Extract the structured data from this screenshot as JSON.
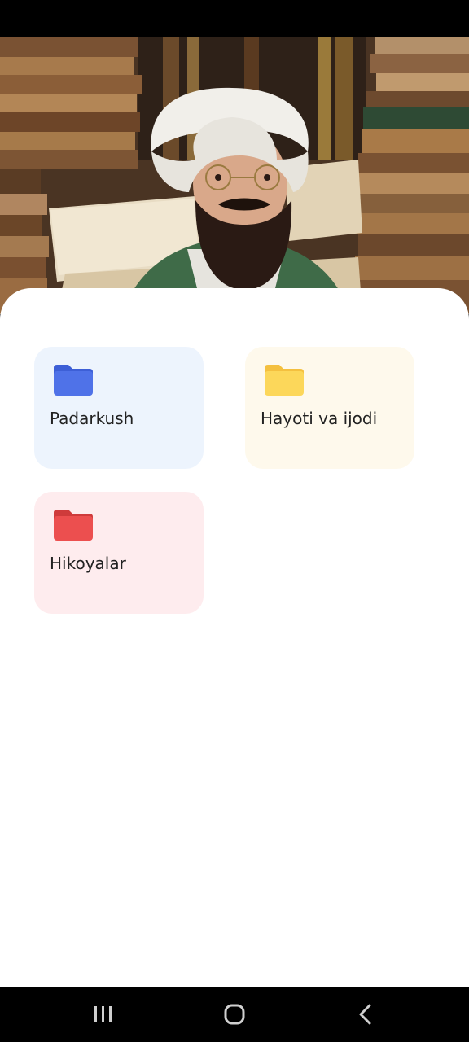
{
  "hero": {
    "alt": "portrait over stacks of old books"
  },
  "folders": [
    {
      "label": "Padarkush",
      "color": "#4f72e8",
      "tab_color": "#3d5fd6"
    },
    {
      "label": "Hayoti va ijodi",
      "color": "#fcd75a",
      "tab_color": "#f4c03f"
    },
    {
      "label": "Hikoyalar",
      "color": "#ec4f4f",
      "tab_color": "#cf3b3b"
    }
  ],
  "icons": {
    "folder": "folder-icon",
    "recents": "recents-icon",
    "home": "home-icon",
    "back": "back-icon"
  }
}
